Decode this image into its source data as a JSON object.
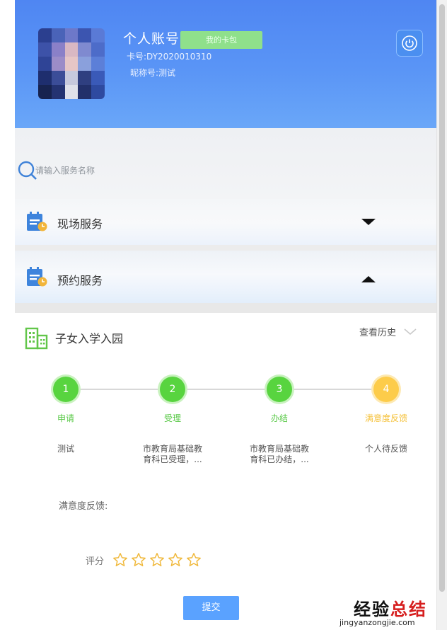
{
  "header": {
    "account_title": "个人账号",
    "card_badge": "我的卡包",
    "card_no": "卡号:DY2020010310",
    "nickname": "昵称号:测试"
  },
  "search": {
    "placeholder": "请输入服务名称"
  },
  "services": [
    {
      "label": "现场服务",
      "state": "collapsed"
    },
    {
      "label": "预约服务",
      "state": "expanded"
    }
  ],
  "section": {
    "title": "子女入学入园",
    "history_link": "查看历史"
  },
  "steps": [
    {
      "number": "1",
      "label": "申请",
      "desc_line1": "测试",
      "desc_line2": "",
      "color": "#58d43f"
    },
    {
      "number": "2",
      "label": "受理",
      "desc_line1": "市教育局基础教",
      "desc_line2": "育科已受理，...",
      "color": "#58d43f"
    },
    {
      "number": "3",
      "label": "办结",
      "desc_line1": "市教育局基础教",
      "desc_line2": "育科已办结，...",
      "color": "#58d43f"
    },
    {
      "number": "4",
      "label": "满意度反馈",
      "desc_line1": "个人待反馈",
      "desc_line2": "",
      "color": "#fdcc4a"
    }
  ],
  "feedback": {
    "label": "满意度反馈:",
    "rating_label": "评分",
    "rating": 0,
    "rating_max": 5
  },
  "submit_label": "提交",
  "watermark": {
    "text_part1": "经验",
    "text_part2": "总结",
    "url": "jingyanzongjie.com"
  },
  "colors": {
    "header_blue": "#5a95f6",
    "step_green": "#58d43f",
    "step_yellow": "#fdcc4a",
    "submit_blue": "#5aa2ff"
  }
}
